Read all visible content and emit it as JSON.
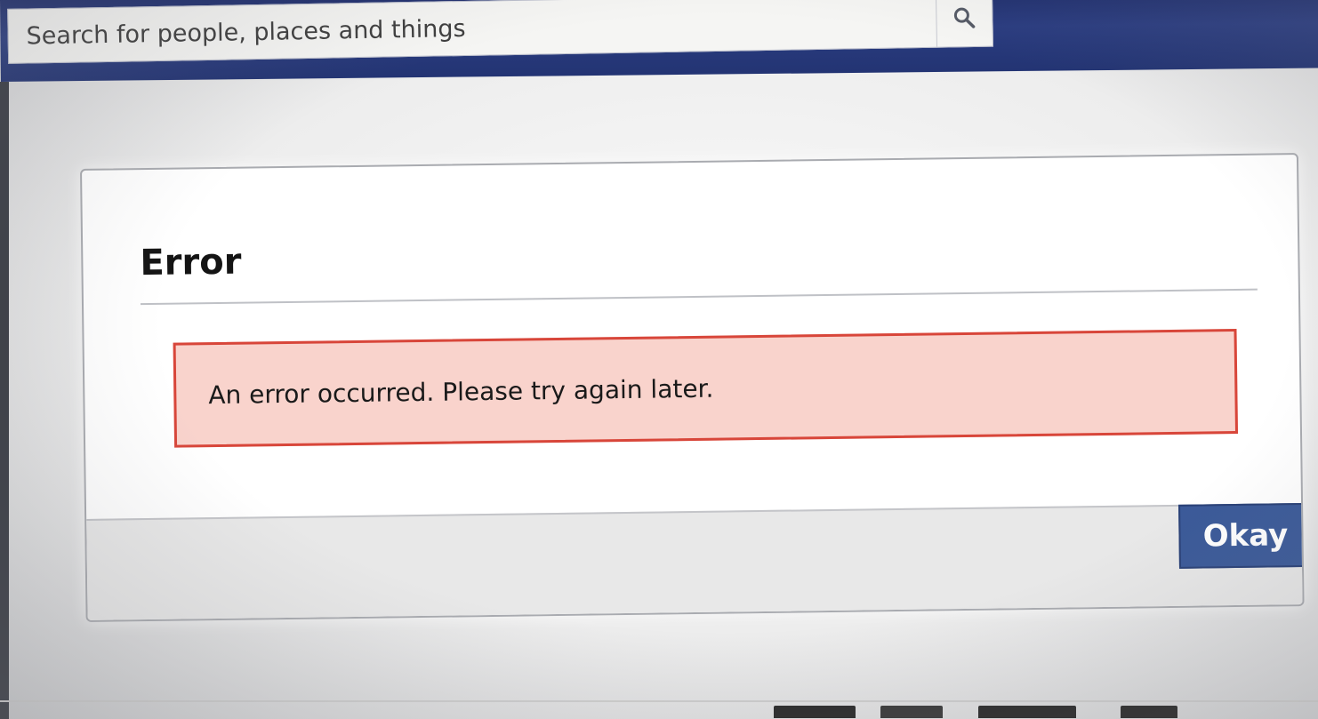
{
  "header": {
    "search": {
      "placeholder": "Search for people, places and things",
      "icon": "search-icon"
    },
    "bar_color": "#233473"
  },
  "dialog": {
    "title": "Error",
    "message": "An error occurred. Please try again later.",
    "confirm_label": "Okay",
    "colors": {
      "error_background": "#f9d3cc",
      "error_border": "#d8463a",
      "button": "#3b5a99"
    }
  }
}
